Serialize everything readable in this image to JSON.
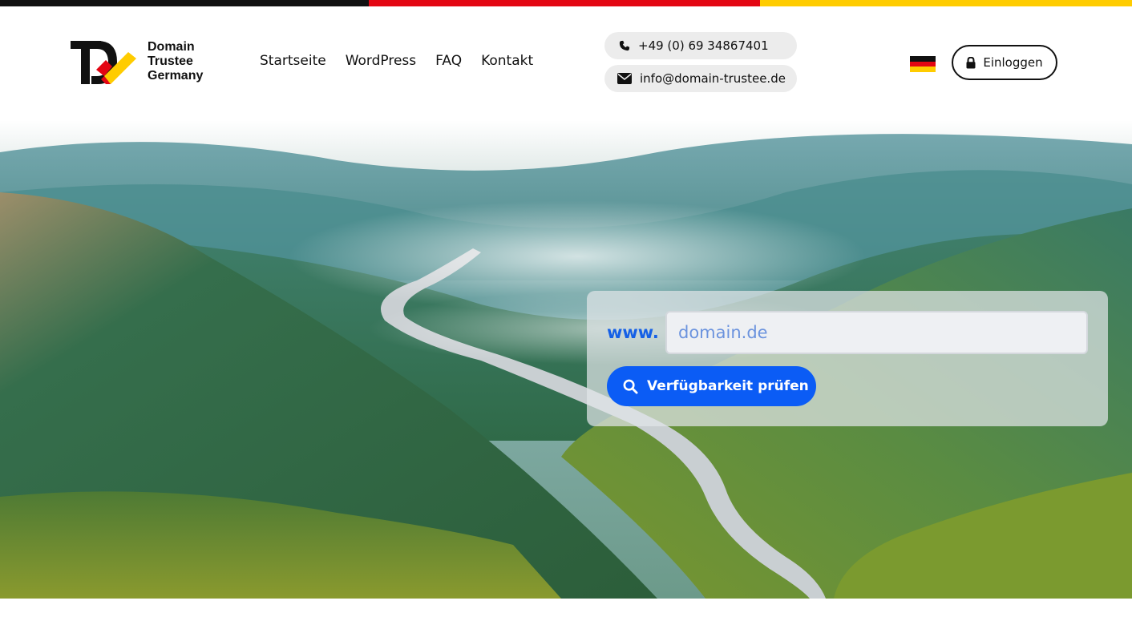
{
  "brand": {
    "name_line1": "Domain",
    "name_line2": "Trustee",
    "name_line3": "Germany",
    "colors": {
      "black": "#111111",
      "red": "#e30613",
      "gold": "#ffcc00"
    }
  },
  "nav": {
    "items": [
      {
        "label": "Startseite"
      },
      {
        "label": "WordPress"
      },
      {
        "label": "FAQ"
      },
      {
        "label": "Kontakt"
      }
    ]
  },
  "contact": {
    "phone": "+49 (0) 69 34867401",
    "email": "info@domain-trustee.de",
    "phone_icon": "phone-icon",
    "email_icon": "envelope-icon"
  },
  "language": {
    "icon": "german-flag-icon"
  },
  "login": {
    "label": "Einloggen",
    "icon": "lock-icon"
  },
  "search": {
    "prefix": "www.",
    "placeholder": "domain.de",
    "value": "",
    "button_label": "Verfügbarkeit prüfen",
    "button_icon": "search-icon",
    "accent_color": "#0b5cf5"
  }
}
